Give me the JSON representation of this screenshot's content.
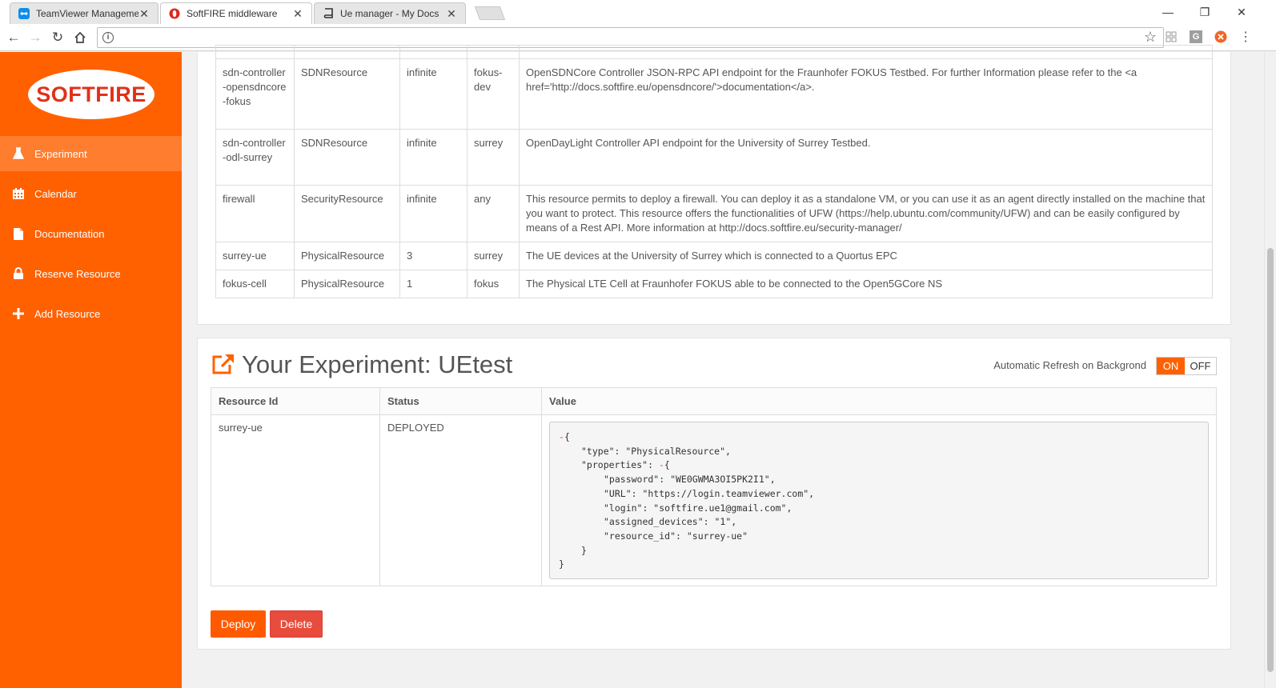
{
  "browser": {
    "tabs": [
      {
        "title": "TeamViewer Managemer",
        "active": false
      },
      {
        "title": "SoftFIRE middleware",
        "active": true
      },
      {
        "title": "Ue manager - My Docs",
        "active": false
      }
    ]
  },
  "sidebar": {
    "logo_text": "SOFTFIRE",
    "items": [
      {
        "label": "Experiment",
        "icon": "flask-icon",
        "active": true
      },
      {
        "label": "Calendar",
        "icon": "calendar-icon",
        "active": false
      },
      {
        "label": "Documentation",
        "icon": "document-icon",
        "active": false
      },
      {
        "label": "Reserve Resource",
        "icon": "lock-icon",
        "active": false
      },
      {
        "label": "Add Resource",
        "icon": "plus-icon",
        "active": false
      }
    ]
  },
  "resources_table": {
    "rows": [
      {
        "id": "sdn-controller-opensdncore-fokus",
        "type": "SDNResource",
        "cardinality": "infinite",
        "testbed": "fokus-dev",
        "description": "OpenSDNCore Controller JSON-RPC API endpoint for the Fraunhofer FOKUS Testbed. For further Information please refer to the <a href='http://docs.softfire.eu/opensdncore/'>documentation</a>."
      },
      {
        "id": "sdn-controller-odl-surrey",
        "type": "SDNResource",
        "cardinality": "infinite",
        "testbed": "surrey",
        "description": "OpenDayLight Controller API endpoint for the University of Surrey Testbed."
      },
      {
        "id": "firewall",
        "type": "SecurityResource",
        "cardinality": "infinite",
        "testbed": "any",
        "description": "This resource permits to deploy a firewall. You can deploy it as a standalone VM, or you can use it as an agent directly installed on the machine that you want to protect. This resource offers the functionalities of UFW (https://help.ubuntu.com/community/UFW) and can be easily configured by means of a Rest API. More information at http://docs.softfire.eu/security-manager/"
      },
      {
        "id": "surrey-ue",
        "type": "PhysicalResource",
        "cardinality": "3",
        "testbed": "surrey",
        "description": "The UE devices at the University of Surrey which is connected to a Quortus EPC"
      },
      {
        "id": "fokus-cell",
        "type": "PhysicalResource",
        "cardinality": "1",
        "testbed": "fokus",
        "description": "The Physical LTE Cell at Fraunhofer FOKUS able to be connected to the Open5GCore NS"
      }
    ]
  },
  "experiment": {
    "title": "Your Experiment: UEtest",
    "refresh_label": "Automatic Refresh on Backgrond",
    "toggle_on": "ON",
    "toggle_off": "OFF",
    "columns": [
      "Resource Id",
      "Status",
      "Value"
    ],
    "row": {
      "resource_id": "surrey-ue",
      "status": "DEPLOYED",
      "json_lines": [
        {
          "text": "-{",
          "indent": 0,
          "collapse": true
        },
        {
          "text": "\"type\": \"PhysicalResource\",",
          "indent": 1
        },
        {
          "text": "\"properties\": -{",
          "indent": 1,
          "has_collapse": true
        },
        {
          "text": "\"password\": \"WE0GWMA3OI5PK2I1\",",
          "indent": 2
        },
        {
          "text": "\"URL\": \"https://login.teamviewer.com\",",
          "indent": 2
        },
        {
          "text": "\"login\": \"softfire.ue1@gmail.com\",",
          "indent": 2
        },
        {
          "text": "\"assigned_devices\": \"1\",",
          "indent": 2
        },
        {
          "text": "\"resource_id\": \"surrey-ue\"",
          "indent": 2
        },
        {
          "text": "}",
          "indent": 1
        },
        {
          "text": "}",
          "indent": 0
        }
      ]
    },
    "buttons": {
      "deploy": "Deploy",
      "delete": "Delete"
    }
  },
  "colors": {
    "brand": "#ff6100",
    "delete": "#e74c3c",
    "deploy": "#ff5a00"
  }
}
